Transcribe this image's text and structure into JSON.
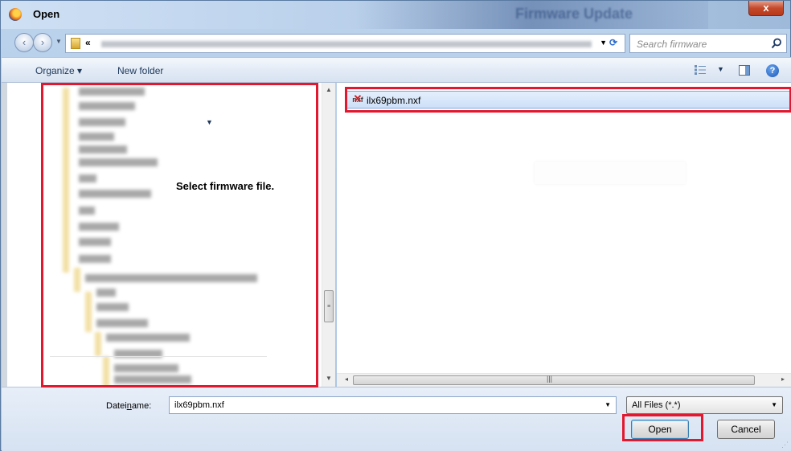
{
  "window": {
    "title": "Open",
    "background_title": "Firmware Update",
    "close_label": "x"
  },
  "nav": {
    "back_icon": "‹",
    "forward_icon": "›",
    "address_chevron": "«",
    "refresh_icon": "⟳",
    "search_placeholder": "Search firmware"
  },
  "toolbar": {
    "organize_label": "Organize ▾",
    "new_folder_label": "New folder",
    "help_label": "?"
  },
  "tree": {
    "note": "Select firmware file."
  },
  "files": [
    {
      "name": "ilx69pbm.nxf",
      "icon_text": "nxf"
    }
  ],
  "bottom": {
    "filename_label_pre": "Datei",
    "filename_label_u": "n",
    "filename_label_post": "ame:",
    "filename_value": "ilx69pbm.nxf",
    "filetype_value": "All Files (*.*)",
    "open_label": "Open",
    "cancel_label": "Cancel"
  },
  "colors": {
    "annotation": "#e3172d",
    "selection": "#cde0f8"
  }
}
